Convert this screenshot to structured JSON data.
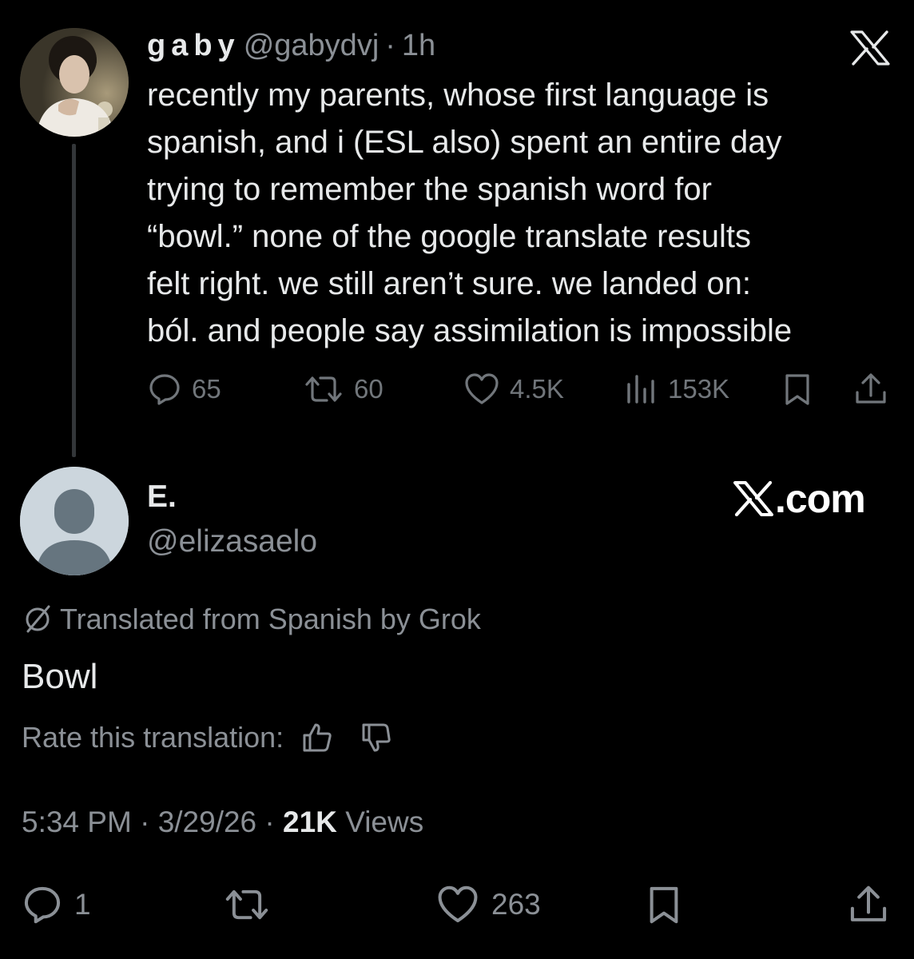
{
  "parent_tweet": {
    "display_name": "gaby",
    "handle": "@gabydvj",
    "separator": "·",
    "time": "1h",
    "text_lines": [
      "recently my parents, whose first language is",
      "spanish, and i (ESL also) spent an entire day",
      "trying to remember the spanish word for",
      "“bowl.” none of the google translate results",
      "felt right. we still aren’t sure. we landed on:",
      "ból. and people say assimilation is impossible"
    ],
    "actions": {
      "replies": "65",
      "reposts": "60",
      "likes": "4.5K",
      "views": "153K"
    }
  },
  "reply_tweet": {
    "display_name": "E.",
    "handle": "@elizasaelo",
    "brand": ".com",
    "translation_note": "Translated from Spanish by Grok",
    "text": "Bowl",
    "rate_label": "Rate this translation:",
    "time": "5:34 PM",
    "separator": "·",
    "date": "3/29/26",
    "views_count": "21K",
    "views_label": "Views",
    "actions": {
      "replies": "1",
      "likes": "263"
    }
  },
  "icons": {
    "reply": "reply-icon",
    "repost": "repost-icon",
    "like": "like-icon",
    "views": "views-icon",
    "bookmark": "bookmark-icon",
    "share": "share-icon",
    "x_logo": "x-logo-icon",
    "translate": "translate-icon",
    "thumbs_up": "thumbs-up-icon",
    "thumbs_down": "thumbs-down-icon"
  },
  "colors": {
    "background": "#000000",
    "text_primary": "#e7e9ea",
    "text_secondary": "#8b9096",
    "thread_line": "#333639",
    "default_avatar": "#ccd6dd"
  }
}
